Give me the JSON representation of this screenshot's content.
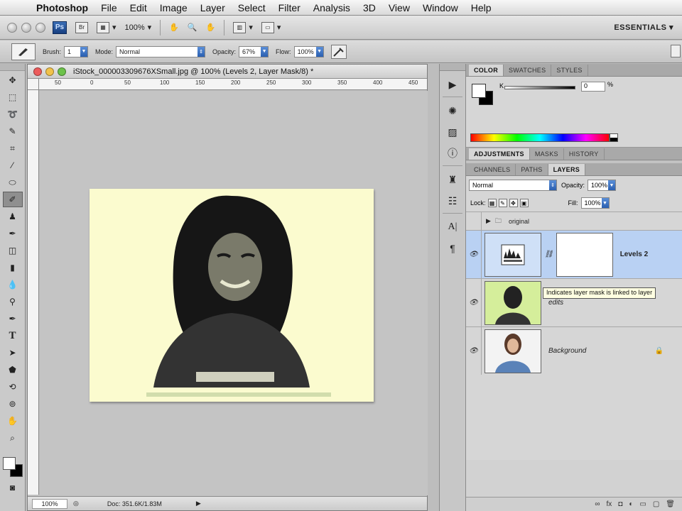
{
  "menubar": {
    "app_name": "Photoshop",
    "items": [
      "File",
      "Edit",
      "Image",
      "Layer",
      "Select",
      "Filter",
      "Analysis",
      "3D",
      "View",
      "Window",
      "Help"
    ]
  },
  "appbar": {
    "ps_badge": "Ps",
    "br_badge": "Br",
    "zoom": "100%",
    "workspace": "ESSENTIALS"
  },
  "options": {
    "brush_label": "Brush:",
    "brush_size": "1",
    "mode_label": "Mode:",
    "mode_value": "Normal",
    "opacity_label": "Opacity:",
    "opacity_value": "67%",
    "flow_label": "Flow:",
    "flow_value": "100%"
  },
  "document": {
    "title": "iStock_000003309676XSmall.jpg @ 100% (Levels 2, Layer Mask/8) *",
    "ruler_ticks": [
      "50",
      "0",
      "50",
      "100",
      "150",
      "200",
      "250",
      "300",
      "350",
      "400",
      "450"
    ],
    "zoom": "100%",
    "doc_info": "Doc: 351.6K/1.83M"
  },
  "color_panel": {
    "tabs": [
      "COLOR",
      "SWATCHES",
      "STYLES"
    ],
    "k_label": "K",
    "k_value": "0",
    "k_pct": "%"
  },
  "adjust_panel": {
    "tabs": [
      "ADJUSTMENTS",
      "MASKS",
      "HISTORY"
    ]
  },
  "layers_panel": {
    "tabs": [
      "CHANNELS",
      "PATHS",
      "LAYERS"
    ],
    "blend_mode": "Normal",
    "opacity_label": "Opacity:",
    "opacity_value": "100%",
    "lock_label": "Lock:",
    "fill_label": "Fill:",
    "fill_value": "100%",
    "layers": [
      {
        "name": "original",
        "type": "group"
      },
      {
        "name": "Levels 2",
        "type": "adjustment"
      },
      {
        "name": "edits",
        "type": "pixel"
      },
      {
        "name": "Background",
        "type": "background"
      }
    ]
  },
  "tooltip": "Indicates layer mask is linked to layer",
  "colors": {
    "image_bg": "#fbfbcf",
    "selected_layer": "#b9d1f3",
    "accent_blue": "#2a5fb0"
  }
}
